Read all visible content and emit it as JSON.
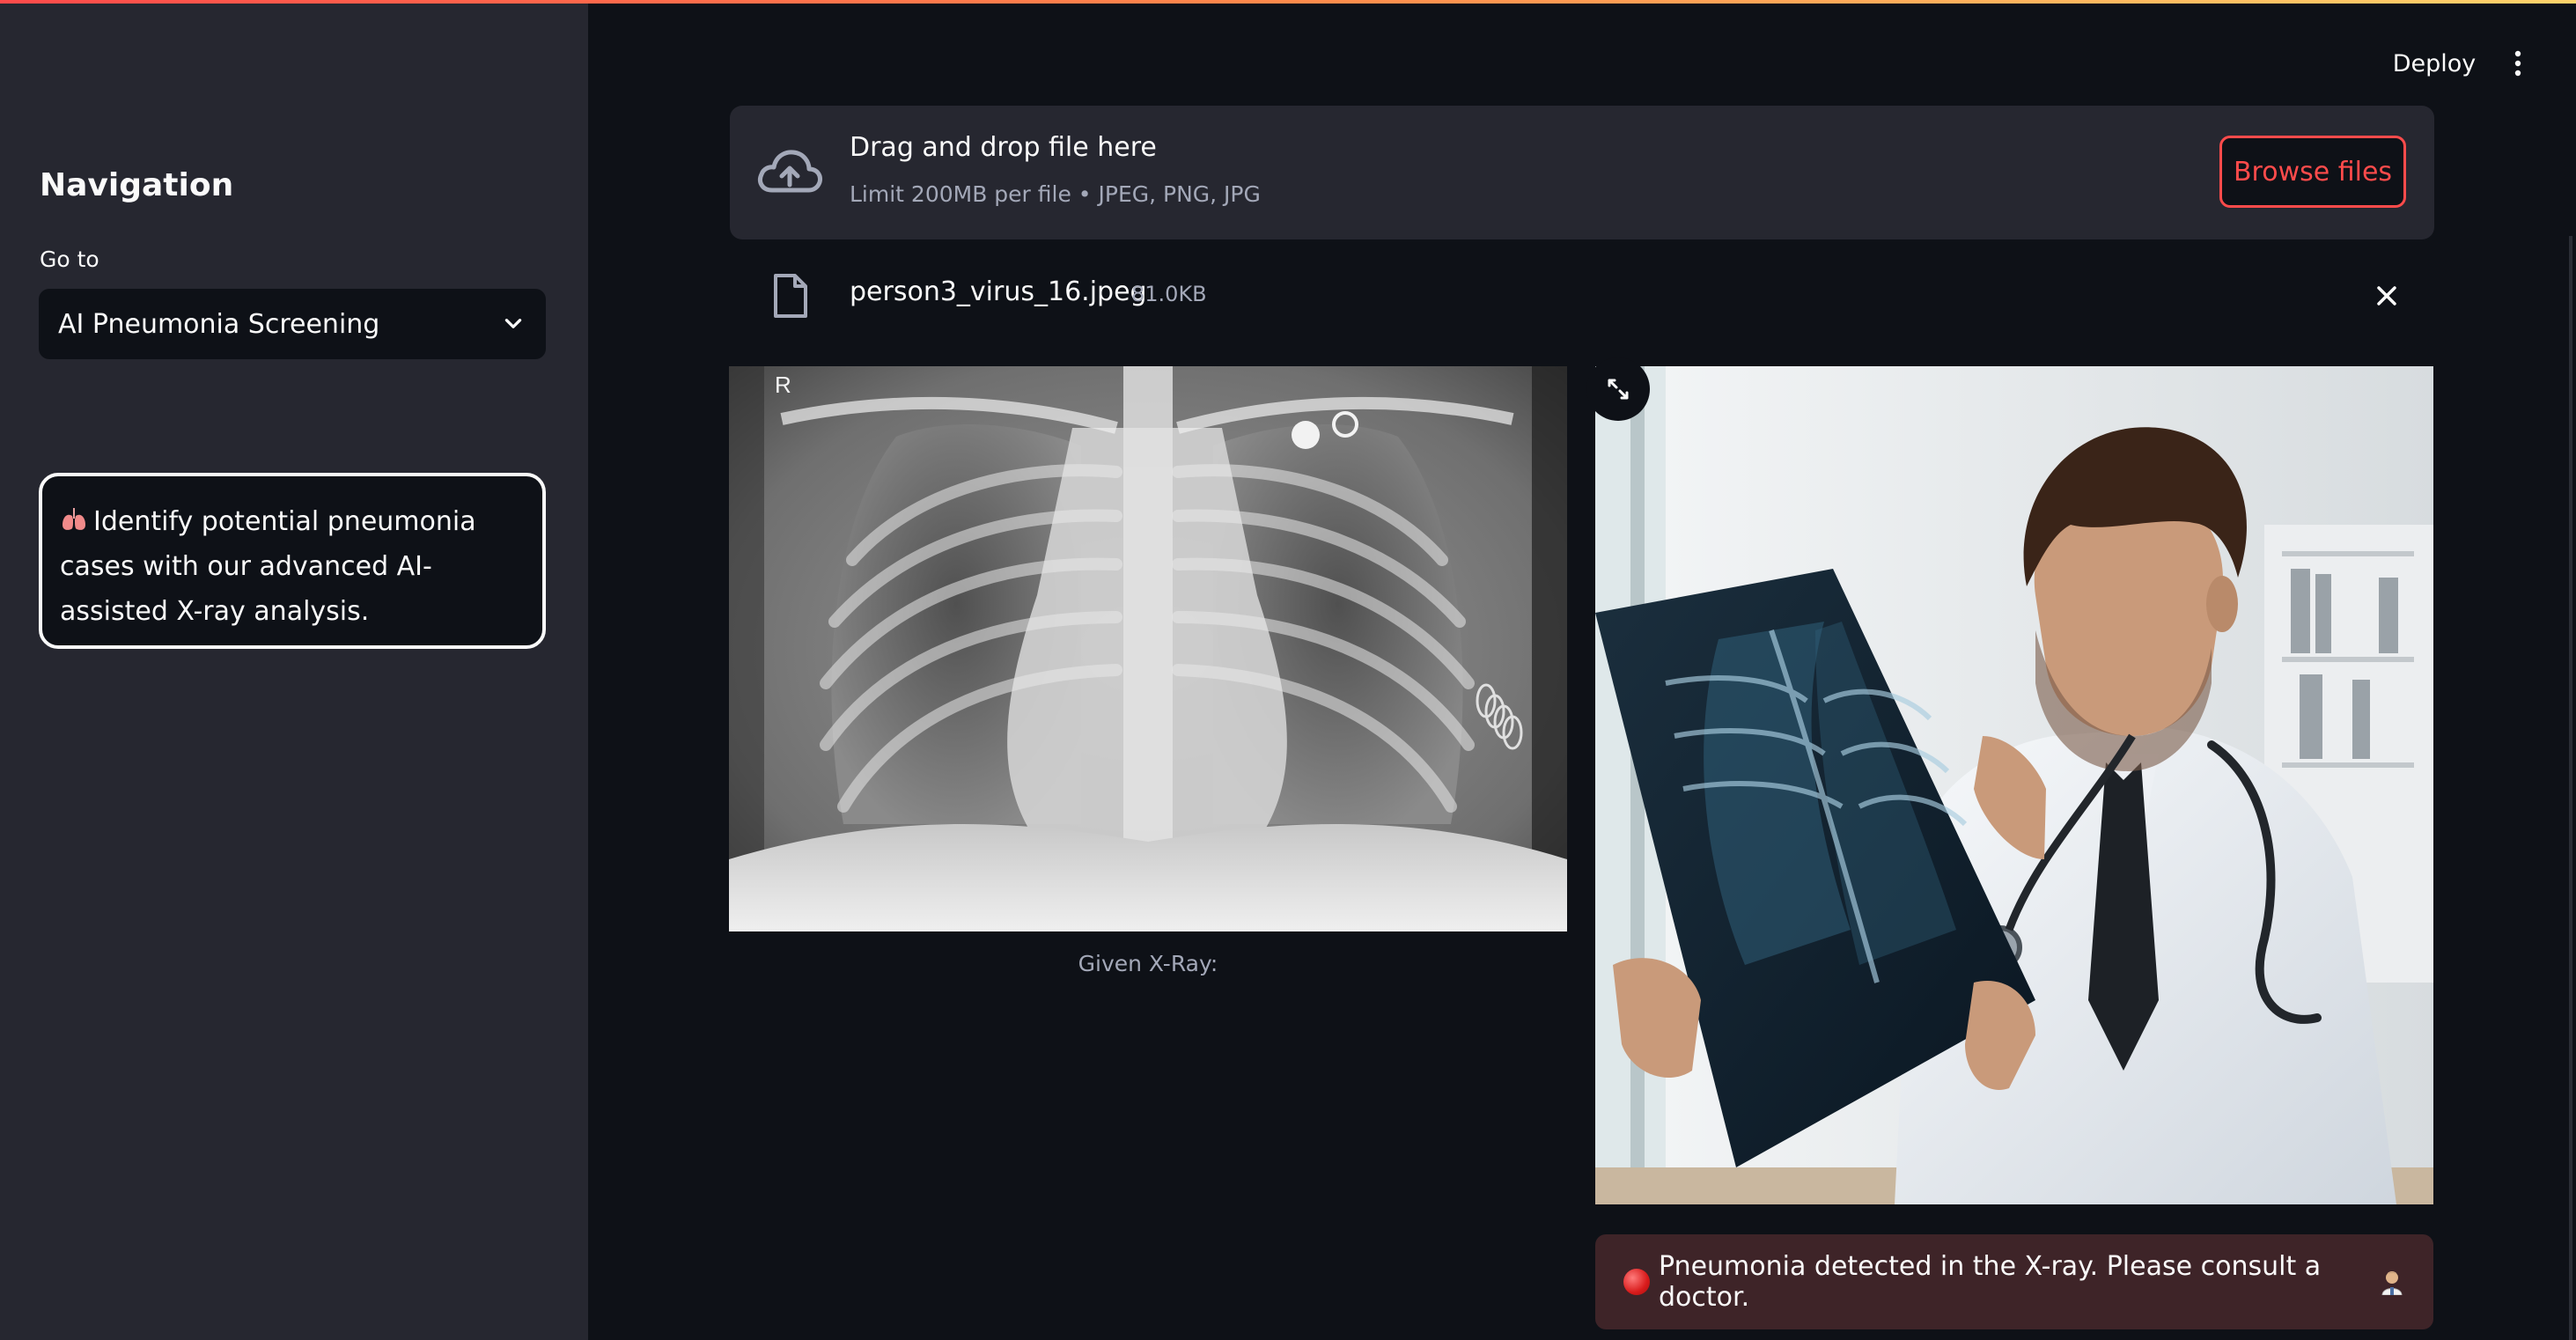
{
  "header": {
    "deploy_label": "Deploy"
  },
  "sidebar": {
    "title": "Navigation",
    "goto_label": "Go to",
    "selected_page": "AI Pneumonia Screening",
    "info_text": "Identify potential pneumonia cases with our advanced AI-assisted X-ray analysis."
  },
  "uploader": {
    "title": "Drag and drop file here",
    "limit_text": "Limit 200MB per file • JPEG, PNG, JPG",
    "browse_label": "Browse files",
    "file_name": "person3_virus_16.jpeg",
    "file_size": "81.0KB"
  },
  "xray": {
    "corner_marker": "R",
    "caption": "Given X-Ray:"
  },
  "result": {
    "message": "Pneumonia detected in the X-ray. Please consult a doctor."
  },
  "colors": {
    "accent": "#ff4b4b",
    "sidebar_bg": "#262730",
    "main_bg": "#0e1117",
    "alert_bg": "#3e2428"
  },
  "icons": [
    "cloud-upload-icon",
    "file-icon",
    "close-icon",
    "chevron-down-icon",
    "kebab-menu-icon",
    "expand-icon",
    "lungs-icon",
    "red-circle-icon",
    "doctor-icon"
  ]
}
